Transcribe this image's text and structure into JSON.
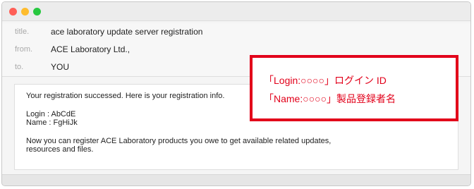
{
  "email": {
    "headers": [
      {
        "label": "title.",
        "value": "ace laboratory update server registration"
      },
      {
        "label": "from.",
        "value": "ACE Laboratory Ltd.,"
      },
      {
        "label": "to.",
        "value": "YOU"
      }
    ],
    "body": {
      "line1": "Your registration successed. Here is your registration info.",
      "login": "Login : AbCdE",
      "name": "Name : FgHiJk",
      "line4": "Now you can  register ACE Laboratory products you owe to get available related updates,",
      "line5": "resources and files."
    }
  },
  "callout": {
    "line1": "「Login:○○○○」ログイン ID",
    "line2": "「Name:○○○○」製品登録者名",
    "color": "#e2001a"
  },
  "window_controls": {
    "close_color": "#ff5f57",
    "minimize_color": "#febc2e",
    "zoom_color": "#28c840"
  }
}
